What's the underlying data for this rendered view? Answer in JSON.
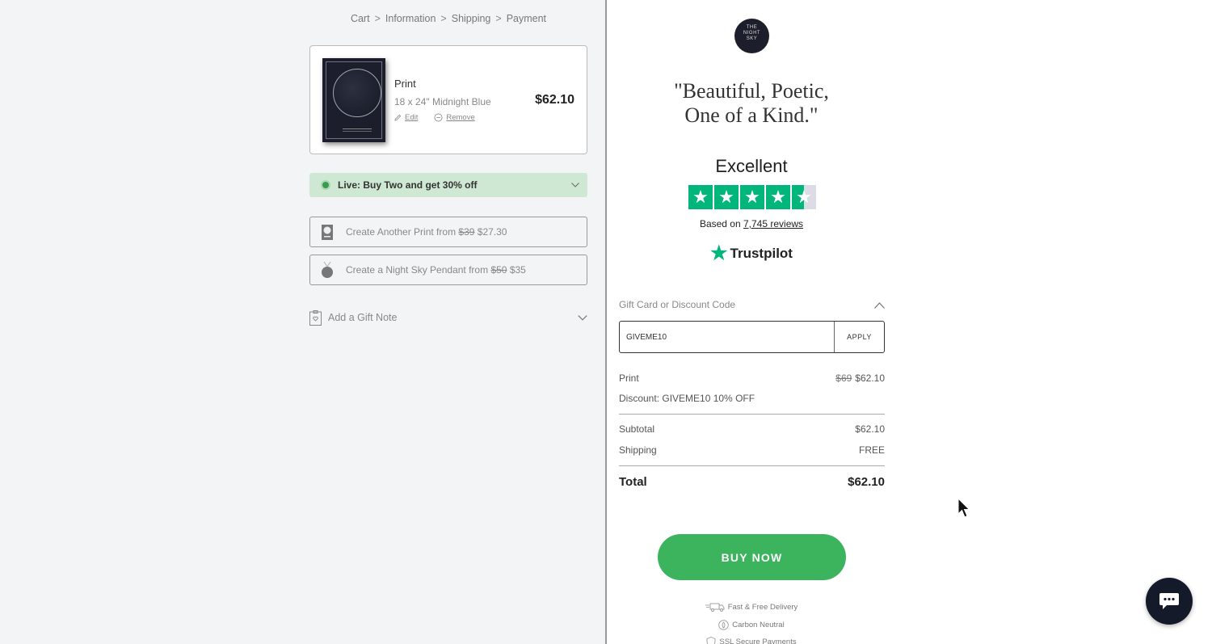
{
  "breadcrumb": {
    "cart": "Cart",
    "information": "Information",
    "shipping": "Shipping",
    "payment": "Payment",
    "sep": ">"
  },
  "cart_item": {
    "name": "Print",
    "variant": "18 x 24\" Midnight Blue",
    "edit": "Edit",
    "remove": "Remove",
    "price": "$62.10"
  },
  "promo": {
    "text": "Live: Buy Two and get 30% off"
  },
  "upsells": [
    {
      "label": "Create Another Print from",
      "old_price": "$39",
      "new_price": "$27.30",
      "icon": "print-icon"
    },
    {
      "label": "Create a Night Sky Pendant from",
      "old_price": "$50",
      "new_price": "$35",
      "icon": "pendant-icon"
    }
  ],
  "gift_note": {
    "label": "Add a Gift Note"
  },
  "brand": {
    "logo_line1": "THE",
    "logo_line2": "NIGHT",
    "logo_line3": "SKY"
  },
  "testimonial": {
    "line1": "\"Beautiful, Poetic,",
    "line2": "One of a Kind.\""
  },
  "rating": {
    "label": "Excellent",
    "stars": 4.5,
    "based_on": "Based on",
    "reviews": "7,745 reviews",
    "provider": "Trustpilot"
  },
  "discount": {
    "label": "Gift Card or Discount Code",
    "value": "GIVEME10",
    "apply": "APPLY"
  },
  "summary": {
    "item_label": "Print",
    "item_old_price": "$69",
    "item_price": "$62.10",
    "discount_line": "Discount: GIVEME10 10% OFF",
    "subtotal_label": "Subtotal",
    "subtotal_value": "$62.10",
    "shipping_label": "Shipping",
    "shipping_value": "FREE",
    "total_label": "Total",
    "total_value": "$62.10"
  },
  "cta": {
    "buy_now": "BUY NOW"
  },
  "perks": [
    "Fast & Free Delivery",
    "Carbon Neutral",
    "SSL Secure Payments"
  ],
  "colors": {
    "accent_green": "#3cb35d",
    "trustpilot_green": "#00b67a",
    "promo_bg": "#cfe8d3",
    "dark_navy": "#151a2a"
  }
}
